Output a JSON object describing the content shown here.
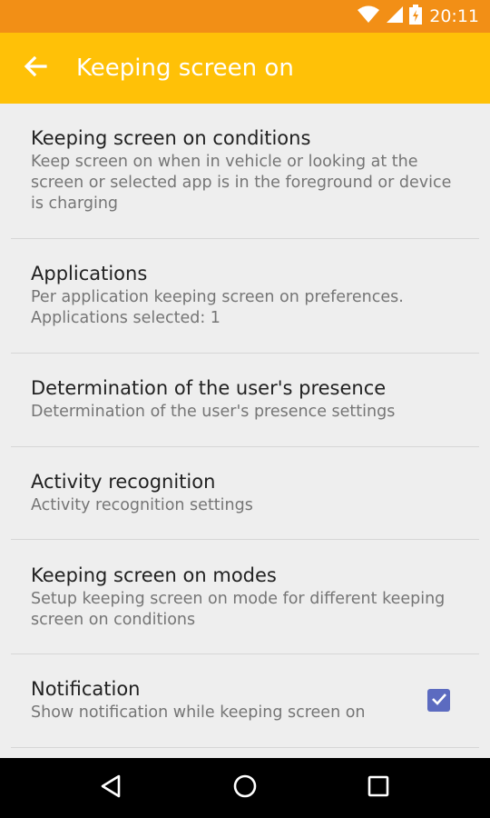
{
  "status_bar": {
    "time": "20:11",
    "icons": [
      "wifi-icon",
      "signal-icon",
      "battery-icon"
    ],
    "color": "#f28f16"
  },
  "app_bar": {
    "title": "Keeping screen on",
    "back_icon": "arrow-back-icon",
    "color": "#ffc107"
  },
  "settings": [
    {
      "title": "Keeping screen on conditions",
      "summary": "Keep screen on when in vehicle or looking at the screen or selected app is in the foreground or device is charging"
    },
    {
      "title": "Applications",
      "summary": "Per application keeping screen on preferences. Applications selected: 1"
    },
    {
      "title": "Determination of the user's presence",
      "summary": "Determination of the user's presence settings"
    },
    {
      "title": "Activity recognition",
      "summary": "Activity recognition settings"
    },
    {
      "title": "Keeping screen on modes",
      "summary": "Setup keeping screen on mode for different keeping screen on conditions"
    },
    {
      "title": "Notification",
      "summary": "Show notification while keeping screen on",
      "checked": true
    }
  ],
  "checkbox_color": "#5c6bc0",
  "nav_bar": {
    "buttons": [
      "back-triangle-icon",
      "home-circle-icon",
      "recents-square-icon"
    ]
  }
}
